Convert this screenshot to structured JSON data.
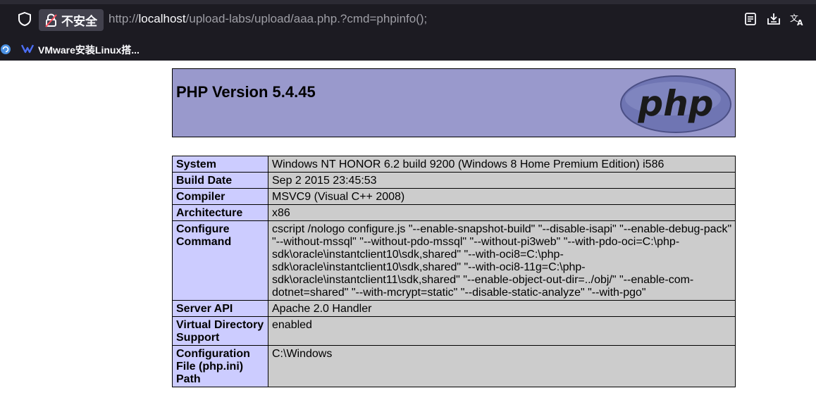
{
  "browser": {
    "security_label": "不安全",
    "url_prefix": "http://",
    "url_host": "localhost",
    "url_path": "/upload-labs/upload/aaa.php.?cmd=phpinfo();",
    "bookmark": "VMware安装Linux搭..."
  },
  "phpinfo": {
    "title": "PHP Version 5.4.45",
    "logo_text": "php",
    "rows": [
      {
        "key": "System",
        "value": "Windows NT HONOR 6.2 build 9200 (Windows 8 Home Premium Edition) i586"
      },
      {
        "key": "Build Date",
        "value": "Sep 2 2015 23:45:53"
      },
      {
        "key": "Compiler",
        "value": "MSVC9 (Visual C++ 2008)"
      },
      {
        "key": "Architecture",
        "value": "x86"
      },
      {
        "key": "Configure Command",
        "value": "cscript /nologo configure.js \"--enable-snapshot-build\" \"--disable-isapi\" \"--enable-debug-pack\" \"--without-mssql\" \"--without-pdo-mssql\" \"--without-pi3web\" \"--with-pdo-oci=C:\\php-sdk\\oracle\\instantclient10\\sdk,shared\" \"--with-oci8=C:\\php-sdk\\oracle\\instantclient10\\sdk,shared\" \"--with-oci8-11g=C:\\php-sdk\\oracle\\instantclient11\\sdk,shared\" \"--enable-object-out-dir=../obj/\" \"--enable-com-dotnet=shared\" \"--with-mcrypt=static\" \"--disable-static-analyze\" \"--with-pgo\""
      },
      {
        "key": "Server API",
        "value": "Apache 2.0 Handler"
      },
      {
        "key": "Virtual Directory Support",
        "value": "enabled"
      },
      {
        "key": "Configuration File (php.ini) Path",
        "value": "C:\\Windows"
      }
    ]
  }
}
